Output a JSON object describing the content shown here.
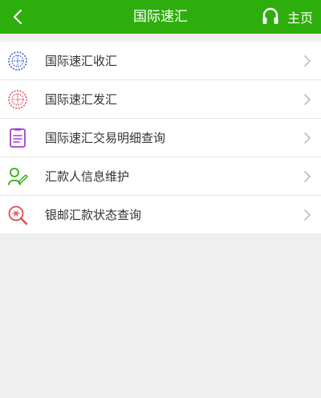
{
  "header": {
    "title": "国际速汇",
    "home_label": "主页",
    "back_icon": "back-arrow-icon",
    "home_icon": "headset-icon"
  },
  "colors": {
    "header_bg": "#2eae0c",
    "background": "#efefef",
    "text": "#333333",
    "chevron": "#bcbcbc"
  },
  "menu": {
    "items": [
      {
        "label": "国际速汇收汇",
        "icon": "globe-receive-icon",
        "icon_color": "#3a62c6"
      },
      {
        "label": "国际速汇发汇",
        "icon": "globe-send-icon",
        "icon_color": "#d9535f"
      },
      {
        "label": "国际速汇交易明细查询",
        "icon": "document-icon",
        "icon_color": "#a442c9"
      },
      {
        "label": "汇款人信息维护",
        "icon": "user-edit-icon",
        "icon_color": "#2eae0c"
      },
      {
        "label": "银邮汇款状态查询",
        "icon": "search-money-icon",
        "icon_color": "#e04b4b"
      }
    ]
  }
}
